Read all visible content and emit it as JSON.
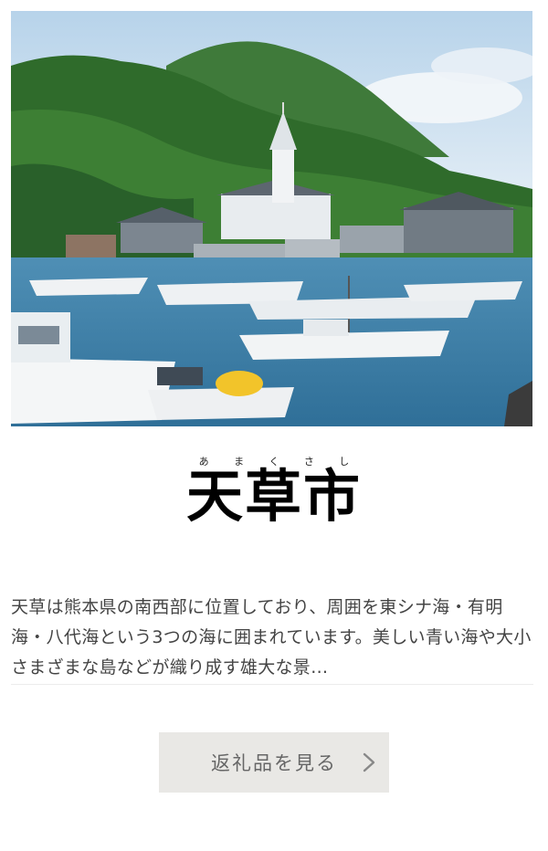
{
  "card": {
    "image_alt": "",
    "ruby": [
      "あ",
      "ま",
      "く",
      "さ",
      "し"
    ],
    "title": "天草市",
    "description": "天草は熊本県の南西部に位置しており、周囲を東シナ海・有明海・八代海という3つの海に囲まれています。美しい青い海や大小さまざまな島などが織り成す雄大な景…",
    "button_label": "返礼品を見る",
    "chevron_icon": "chevron-right-icon"
  },
  "colors": {
    "button_bg": "#e9e8e5",
    "button_text": "#666666",
    "text": "#444444",
    "title": "#000000"
  }
}
